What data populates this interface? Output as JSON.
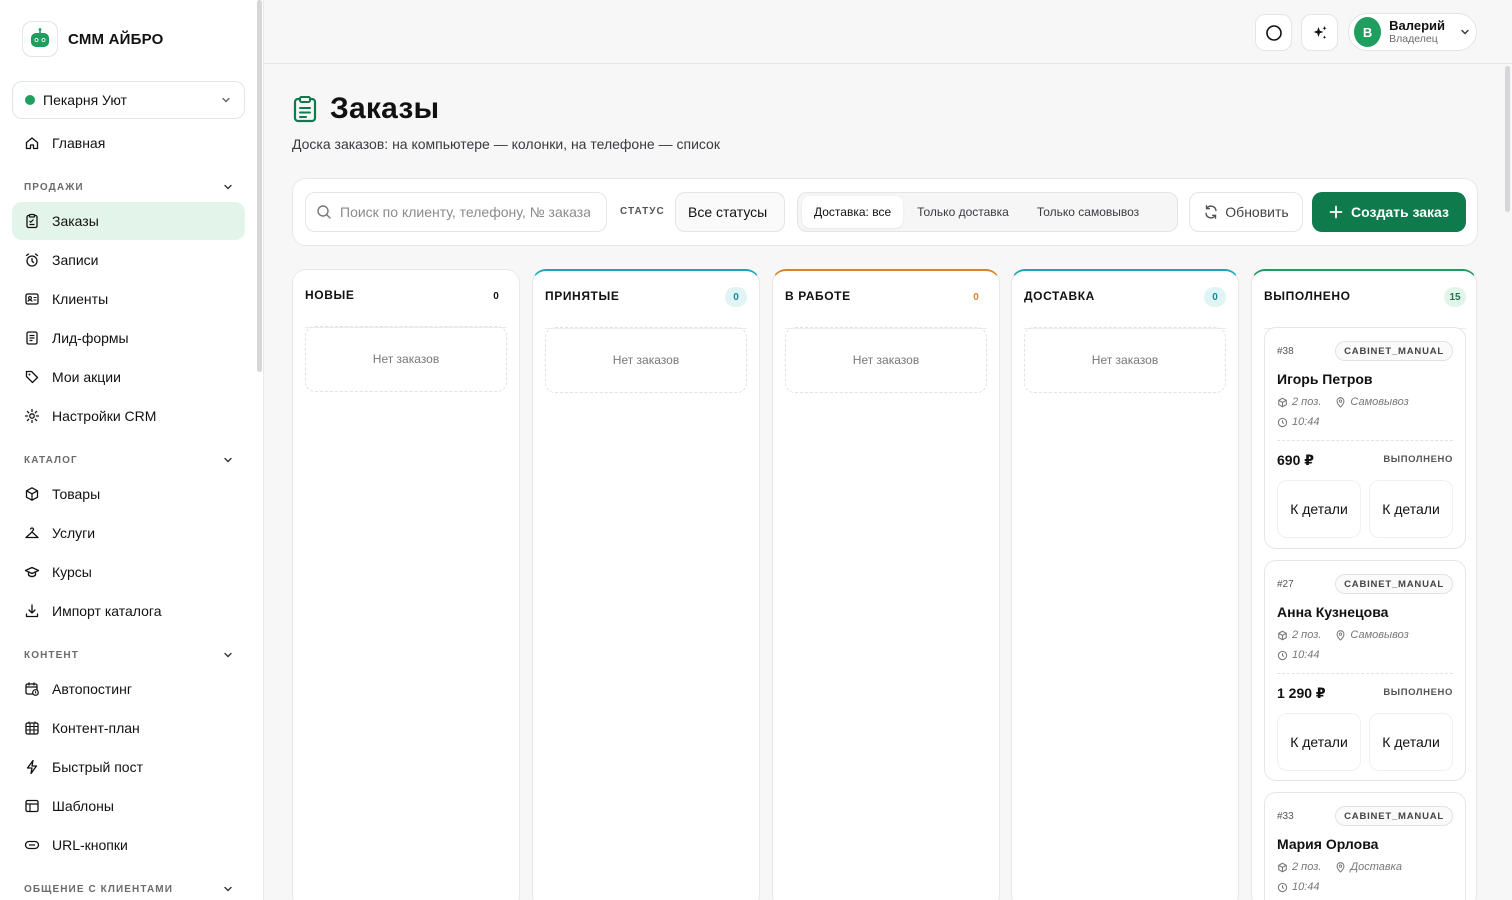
{
  "brand": {
    "name": "СММ АЙБРО"
  },
  "business": {
    "name": "Пекарня Уют"
  },
  "sidebar": {
    "home": "Главная",
    "sales": {
      "title": "ПРОДАЖИ",
      "items": [
        "Заказы",
        "Записи",
        "Клиенты",
        "Лид-формы",
        "Мои акции",
        "Настройки CRM"
      ]
    },
    "catalog": {
      "title": "КАТАЛОГ",
      "items": [
        "Товары",
        "Услуги",
        "Курсы",
        "Импорт каталога"
      ]
    },
    "content": {
      "title": "КОНТЕНТ",
      "items": [
        "Автопостинг",
        "Контент-план",
        "Быстрый пост",
        "Шаблоны",
        "URL-кнопки"
      ]
    },
    "clients": {
      "title": "ОБЩЕНИЕ С КЛИЕНТАМИ"
    }
  },
  "user": {
    "initial": "В",
    "name": "Валерий",
    "role": "Владелец"
  },
  "page": {
    "title": "Заказы",
    "subtitle": "Доска заказов: на компьютере — колонки, на телефоне — список"
  },
  "filters": {
    "search_placeholder": "Поиск по клиенту, телефону, № заказа",
    "status_label": "СТАТУС",
    "status_value": "Все статусы",
    "delivery": [
      "Доставка: все",
      "Только доставка",
      "Только самовывоз"
    ],
    "refresh": "Обновить",
    "create": "Создать заказ"
  },
  "colors": {
    "accent": "#0f7a4c",
    "new": "#e8e8ea",
    "accepted": "#19a7b5",
    "inwork": "#d9822b",
    "delivery": "#19a7b5",
    "done": "#1e9e5f"
  },
  "columns": [
    {
      "title": "НОВЫЕ",
      "count": "0",
      "empty": "Нет заказов"
    },
    {
      "title": "ПРИНЯТЫЕ",
      "count": "0",
      "empty": "Нет заказов"
    },
    {
      "title": "В РАБОТЕ",
      "count": "0",
      "empty": "Нет заказов"
    },
    {
      "title": "ДОСТАВКА",
      "count": "0",
      "empty": "Нет заказов"
    },
    {
      "title": "ВЫПОЛНЕНО",
      "count": "15"
    }
  ],
  "orders": [
    {
      "num": "#38",
      "source": "CABINET_MANUAL",
      "name": "Игорь Петров",
      "items": "2 поз.",
      "method": "Самовывоз",
      "time": "10:44",
      "price": "690 ₽",
      "status": "ВЫПОЛНЕНО",
      "btn": "К детали"
    },
    {
      "num": "#27",
      "source": "CABINET_MANUAL",
      "name": "Анна Кузнецова",
      "items": "2 поз.",
      "method": "Самовывоз",
      "time": "10:44",
      "price": "1 290 ₽",
      "status": "ВЫПОЛНЕНО",
      "btn": "К детали"
    },
    {
      "num": "#33",
      "source": "CABINET_MANUAL",
      "name": "Мария Орлова",
      "items": "2 поз.",
      "method": "Доставка",
      "time": "10:44"
    }
  ]
}
